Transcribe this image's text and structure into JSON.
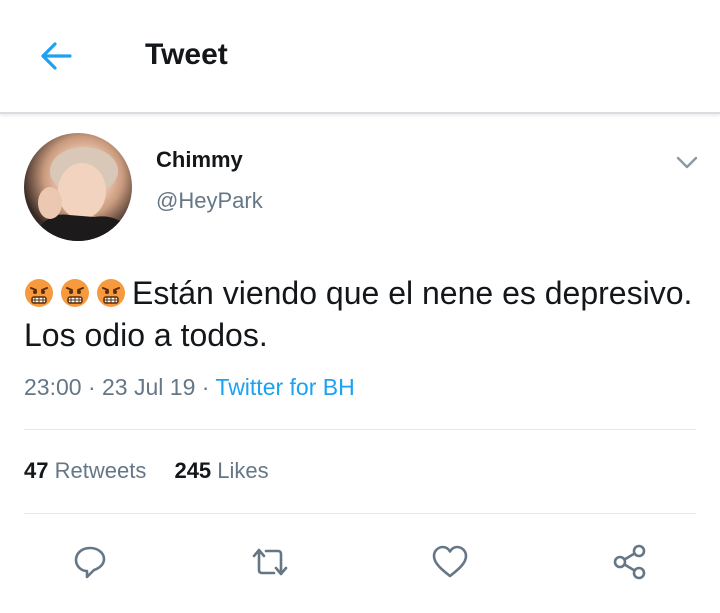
{
  "header": {
    "title": "Tweet",
    "back_icon": "arrow-left-icon",
    "accent": "#1da1f2"
  },
  "tweet": {
    "display_name": "Chimmy",
    "handle": "@HeyPark",
    "emojis": [
      "angry-face-icon",
      "angry-face-icon",
      "angry-face-icon"
    ],
    "text": "Están viendo que el nene es depresivo. Los odio a todos.",
    "time": "23:00",
    "date": "23 Jul 19",
    "client": "Twitter for BH",
    "separator": "·"
  },
  "stats": {
    "retweets_count": "47",
    "retweets_label": "Retweets",
    "likes_count": "245",
    "likes_label": "Likes"
  },
  "actions": [
    "reply-icon",
    "retweet-icon",
    "like-icon",
    "share-icon"
  ],
  "colors": {
    "text": "#14171a",
    "secondary": "#657786",
    "link": "#1da1f2",
    "divider": "#e1e8ed"
  }
}
